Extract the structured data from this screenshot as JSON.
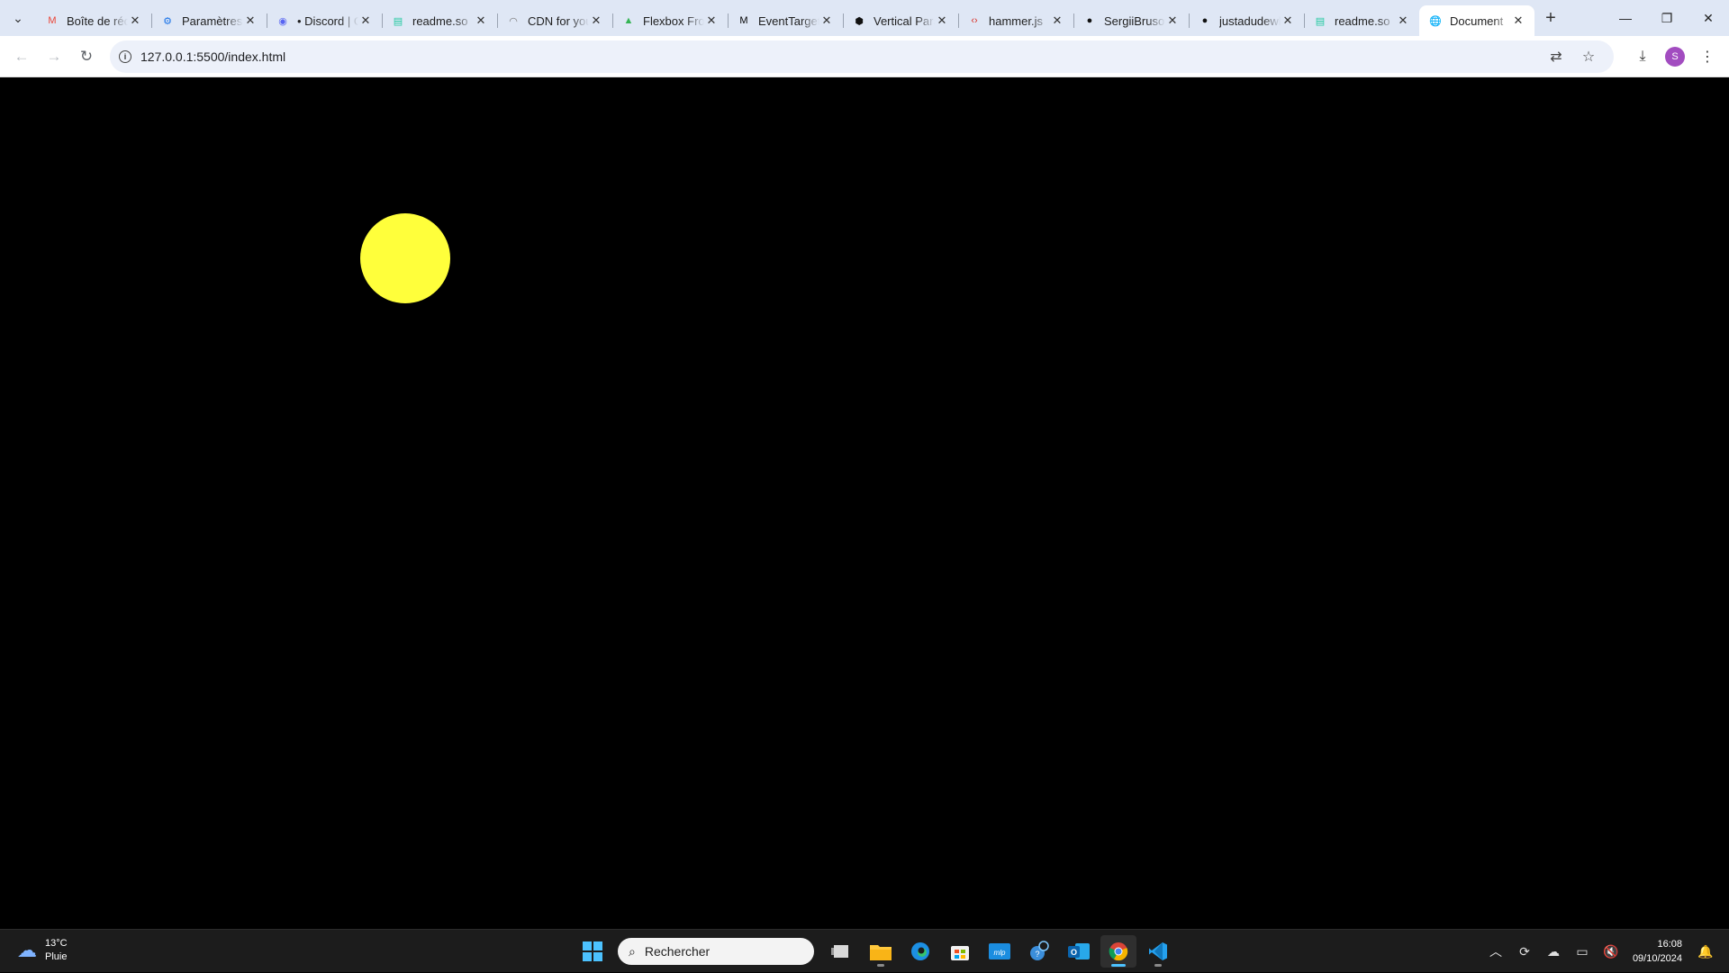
{
  "browser": {
    "tabs": [
      {
        "title": "Boîte de réception",
        "favicon": "gmail-icon",
        "color": "#ea4335",
        "glyph": "M"
      },
      {
        "title": "Paramètres",
        "favicon": "gear-icon",
        "color": "#1a73e8",
        "glyph": "⚙"
      },
      {
        "title": "• Discord | Général",
        "favicon": "discord-icon",
        "color": "#5865f2",
        "glyph": "◉"
      },
      {
        "title": "readme.so",
        "favicon": "readme-icon",
        "color": "#22c9a0",
        "glyph": "▤"
      },
      {
        "title": "CDN for your",
        "favicon": "cdn-icon",
        "color": "#777777",
        "glyph": "◠"
      },
      {
        "title": "Flexbox Froggy",
        "favicon": "frog-icon",
        "color": "#35b454",
        "glyph": "▲"
      },
      {
        "title": "EventTarget",
        "favicon": "mdn-icon",
        "color": "#000000",
        "glyph": "M"
      },
      {
        "title": "Vertical Parallax",
        "favicon": "codepen-icon",
        "color": "#111111",
        "glyph": "⬢"
      },
      {
        "title": "hammer.js",
        "favicon": "code-icon",
        "color": "#d93025",
        "glyph": "‹›"
      },
      {
        "title": "SergiiBrusov",
        "favicon": "github-icon",
        "color": "#111111",
        "glyph": "●"
      },
      {
        "title": "justadudewhohacks",
        "favicon": "github-icon",
        "color": "#111111",
        "glyph": "●"
      },
      {
        "title": "readme.so",
        "favicon": "readme-icon",
        "color": "#22c9a0",
        "glyph": "▤"
      },
      {
        "title": "Document",
        "favicon": "globe-icon",
        "color": "#444444",
        "glyph": "🌐",
        "active": true
      }
    ],
    "url": "127.0.0.1:5500/index.html",
    "profile_initial": "S"
  },
  "page": {
    "ball_color": "#ffff3b",
    "background": "#000000"
  },
  "taskbar": {
    "weather_temp": "13°C",
    "weather_desc": "Pluie",
    "search_placeholder": "Rechercher",
    "time": "16:08",
    "date": "09/10/2024"
  }
}
